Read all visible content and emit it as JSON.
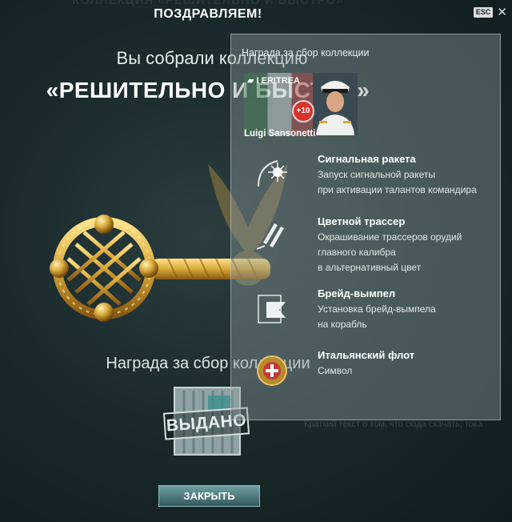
{
  "header": {
    "top_ghost": "КОЛЛЕКЦИЯ «РЕШИТЕЛЬНО И БЫСТРО»",
    "title": "ПОЗДРАВЛЯЕМ!",
    "esc_label": "ESC",
    "close_glyph": "✕"
  },
  "main": {
    "subtitle": "Вы собрали коллекцию",
    "collection_name": "«РЕШИТЕЛЬНО И БЫСТРО»",
    "reward_caption": "Награда за сбор коллекции",
    "issued_stamp": "ВЫДАНО",
    "close_button": "ЗАКРЫТЬ",
    "ghost_text": "Краткий текст о том, что сюда скачать, тока"
  },
  "panel": {
    "title": "Награда за сбор коллекции",
    "commander": {
      "ship": "I ERITREA",
      "badge": "+10",
      "name": "Luigi Sansonetti"
    },
    "items": [
      {
        "title": "Сигнальная ракета",
        "desc": [
          "Запуск сигнальной ракеты",
          "при активации талантов командира"
        ],
        "icon": "signal-flare-icon"
      },
      {
        "title": "Цветной трассер",
        "desc": [
          "Окрашивание трассеров орудий",
          "главного калибра",
          "в альтернативный цвет"
        ],
        "icon": "tracer-shells-icon"
      },
      {
        "title": "Брейд-вымпел",
        "desc": [
          "Установка брейд-вымпела",
          "на корабль"
        ],
        "icon": "pennant-icon"
      },
      {
        "title": "Итальянский флот",
        "desc": [
          "Символ"
        ],
        "icon": "italian-navy-emblem-icon"
      }
    ]
  },
  "colors": {
    "accent": "#4f7f81",
    "badge_red": "#d8322d",
    "gold": "#d9a93a"
  }
}
